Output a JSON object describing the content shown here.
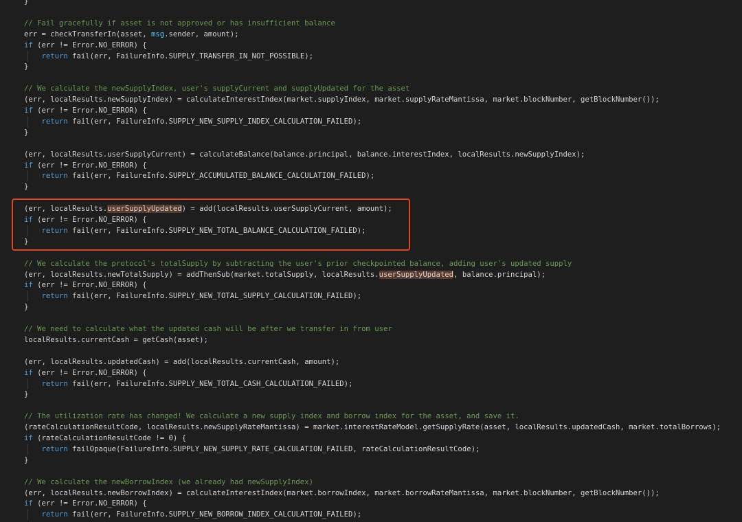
{
  "theme": {
    "background": "#1e1e1e",
    "text": "#d4d4d4",
    "comment": "#6a9955",
    "keyword": "#569cd6",
    "special": "#4fc1ff",
    "highlight_box": "#e0461f",
    "match_highlight": "#5a3a2c"
  },
  "editor": {
    "lines": [
      [
        [
          "plain",
          "}"
        ]
      ],
      [],
      [
        [
          "comment",
          "// Fail gracefully if asset is not approved or has insufficient balance"
        ]
      ],
      [
        [
          "plain",
          "err = checkTransferIn(asset, "
        ],
        [
          "special",
          "msg"
        ],
        [
          "plain",
          ".sender, amount);"
        ]
      ],
      [
        [
          "keyword",
          "if"
        ],
        [
          "plain",
          " (err != Error.NO_ERROR) {"
        ]
      ],
      [
        [
          "plain",
          "    "
        ],
        [
          "keyword",
          "return"
        ],
        [
          "plain",
          " fail(err, FailureInfo.SUPPLY_TRANSFER_IN_NOT_POSSIBLE);"
        ]
      ],
      [
        [
          "plain",
          "}"
        ]
      ],
      [],
      [
        [
          "comment",
          "// We calculate the newSupplyIndex, user's supplyCurrent and supplyUpdated for the asset"
        ]
      ],
      [
        [
          "plain",
          "(err, localResults.newSupplyIndex) = calculateInterestIndex(market.supplyIndex, market.supplyRateMantissa, market.blockNumber, getBlockNumber());"
        ]
      ],
      [
        [
          "keyword",
          "if"
        ],
        [
          "plain",
          " (err != Error.NO_ERROR) {"
        ]
      ],
      [
        [
          "plain",
          "    "
        ],
        [
          "keyword",
          "return"
        ],
        [
          "plain",
          " fail(err, FailureInfo.SUPPLY_NEW_SUPPLY_INDEX_CALCULATION_FAILED);"
        ]
      ],
      [
        [
          "plain",
          "}"
        ]
      ],
      [],
      [
        [
          "plain",
          "(err, localResults.userSupplyCurrent) = calculateBalance(balance.principal, balance.interestIndex, localResults.newSupplyIndex);"
        ]
      ],
      [
        [
          "keyword",
          "if"
        ],
        [
          "plain",
          " (err != Error.NO_ERROR) {"
        ]
      ],
      [
        [
          "plain",
          "    "
        ],
        [
          "keyword",
          "return"
        ],
        [
          "plain",
          " fail(err, FailureInfo.SUPPLY_ACCUMULATED_BALANCE_CALCULATION_FAILED);"
        ]
      ],
      [
        [
          "plain",
          "}"
        ]
      ],
      [],
      [
        [
          "plain",
          "(err, localResults."
        ],
        [
          "hl",
          "userSupplyUpdated"
        ],
        [
          "plain",
          ") = add(localResults.userSupplyCurrent, amount);"
        ]
      ],
      [
        [
          "keyword",
          "if"
        ],
        [
          "plain",
          " (err != Error.NO_ERROR) {"
        ]
      ],
      [
        [
          "plain",
          "    "
        ],
        [
          "keyword",
          "return"
        ],
        [
          "plain",
          " fail(err, FailureInfo.SUPPLY_NEW_TOTAL_BALANCE_CALCULATION_FAILED);"
        ]
      ],
      [
        [
          "plain",
          "}"
        ]
      ],
      [],
      [
        [
          "comment",
          "// We calculate the protocol's totalSupply by subtracting the user's prior checkpointed balance, adding user's updated supply"
        ]
      ],
      [
        [
          "plain",
          "(err, localResults.newTotalSupply) = addThenSub(market.totalSupply, localResults."
        ],
        [
          "hl",
          "userSupplyUpdated"
        ],
        [
          "plain",
          ", balance.principal);"
        ]
      ],
      [
        [
          "keyword",
          "if"
        ],
        [
          "plain",
          " (err != Error.NO_ERROR) {"
        ]
      ],
      [
        [
          "plain",
          "    "
        ],
        [
          "keyword",
          "return"
        ],
        [
          "plain",
          " fail(err, FailureInfo.SUPPLY_NEW_TOTAL_SUPPLY_CALCULATION_FAILED);"
        ]
      ],
      [
        [
          "plain",
          "}"
        ]
      ],
      [],
      [
        [
          "comment",
          "// We need to calculate what the updated cash will be after we transfer in from user"
        ]
      ],
      [
        [
          "plain",
          "localResults.currentCash = getCash(asset);"
        ]
      ],
      [],
      [
        [
          "plain",
          "(err, localResults.updatedCash) = add(localResults.currentCash, amount);"
        ]
      ],
      [
        [
          "keyword",
          "if"
        ],
        [
          "plain",
          " (err != Error.NO_ERROR) {"
        ]
      ],
      [
        [
          "plain",
          "    "
        ],
        [
          "keyword",
          "return"
        ],
        [
          "plain",
          " fail(err, FailureInfo.SUPPLY_NEW_TOTAL_CASH_CALCULATION_FAILED);"
        ]
      ],
      [
        [
          "plain",
          "}"
        ]
      ],
      [],
      [
        [
          "comment",
          "// The utilization rate has changed! We calculate a new supply index and borrow index for the asset, and save it."
        ]
      ],
      [
        [
          "plain",
          "(rateCalculationResultCode, localResults.newSupplyRateMantissa) = market.interestRateModel.getSupplyRate(asset, localResults.updatedCash, market.totalBorrows);"
        ]
      ],
      [
        [
          "keyword",
          "if"
        ],
        [
          "plain",
          " (rateCalculationResultCode != 0) {"
        ]
      ],
      [
        [
          "plain",
          "    "
        ],
        [
          "keyword",
          "return"
        ],
        [
          "plain",
          " failOpaque(FailureInfo.SUPPLY_NEW_SUPPLY_RATE_CALCULATION_FAILED, rateCalculationResultCode);"
        ]
      ],
      [
        [
          "plain",
          "}"
        ]
      ],
      [],
      [
        [
          "comment",
          "// We calculate the newBorrowIndex (we already had newSupplyIndex)"
        ]
      ],
      [
        [
          "plain",
          "(err, localResults.newBorrowIndex) = calculateInterestIndex(market.borrowIndex, market.borrowRateMantissa, market.blockNumber, getBlockNumber());"
        ]
      ],
      [
        [
          "keyword",
          "if"
        ],
        [
          "plain",
          " (err != Error.NO_ERROR) {"
        ]
      ],
      [
        [
          "plain",
          "    "
        ],
        [
          "keyword",
          "return"
        ],
        [
          "plain",
          " fail(err, FailureInfo.SUPPLY_NEW_BORROW_INDEX_CALCULATION_FAILED);"
        ]
      ]
    ]
  }
}
